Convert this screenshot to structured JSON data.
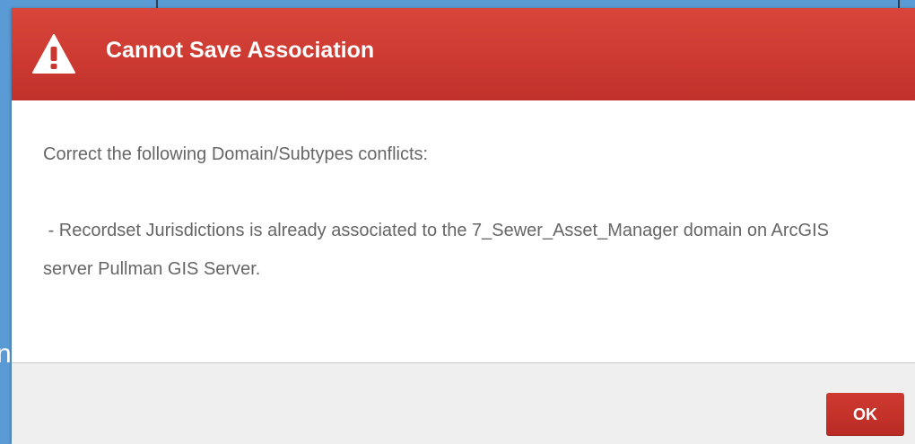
{
  "background": {
    "partial_text": "n",
    "color": "#5b9bd5"
  },
  "dialog": {
    "title": "Cannot Save Association",
    "header_icon": "warning-icon",
    "header_color": "#c9372f",
    "message_intro": "Correct the following Domain/Subtypes conflicts:",
    "message_detail": " - Recordset Jurisdictions is already associated to the 7_Sewer_Asset_Manager domain on ArcGIS server Pullman GIS Server.",
    "ok_label": "OK",
    "ok_color": "#c9372f"
  }
}
